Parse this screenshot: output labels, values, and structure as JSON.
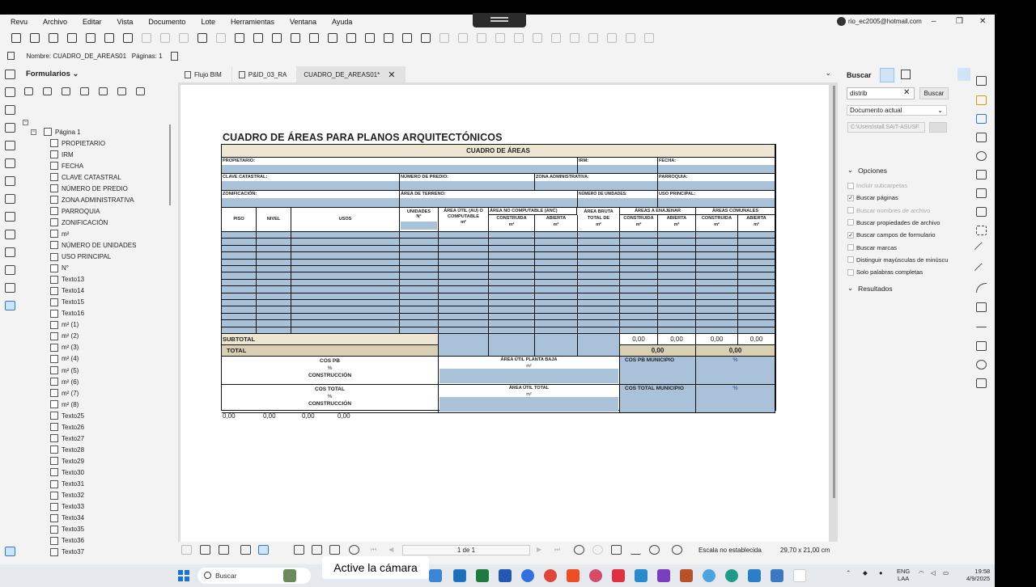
{
  "menu": [
    "Revu",
    "Archivo",
    "Editar",
    "Vista",
    "Documento",
    "Lote",
    "Herramientas",
    "Ventana",
    "Ayuda"
  ],
  "account": "rio_ec2005@hotmail.com",
  "window_controls": [
    "–",
    "❐",
    "✕"
  ],
  "namebar": {
    "name_label": "Nombre:",
    "name_value": "CUADRO_DE_AREAS01",
    "pages_label": "Páginas:",
    "pages_value": "1"
  },
  "panel": {
    "title": "Formularios ⌄",
    "root": "Página 1"
  },
  "tree_items": [
    "PROPIETARIO",
    "IRM",
    "FECHA",
    "CLAVE CATASTRAL",
    "NÚMERO DE PREDIO",
    "ZONA ADMINISTRATIVA",
    "PARROQUIA",
    "ZONIFICACIÓN",
    "m²",
    "NÚMERO DE UNIDADES",
    "USO PRINCIPAL",
    "N°",
    "Texto13",
    "Texto14",
    "Texto15",
    "Texto16",
    "m² (1)",
    "m² (2)",
    "m² (3)",
    "m² (4)",
    "m² (5)",
    "m² (6)",
    "m² (7)",
    "m² (8)",
    "Texto25",
    "Texto26",
    "Texto27",
    "Texto28",
    "Texto29",
    "Texto30",
    "Texto31",
    "Texto32",
    "Texto33",
    "Texto34",
    "Texto35",
    "Texto36",
    "Texto37"
  ],
  "tabs": [
    {
      "label": "Flujo BIM"
    },
    {
      "label": "P&ID_03_RA"
    },
    {
      "label": "CUADRO_DE_AREAS01*"
    }
  ],
  "doc": {
    "title": "CUADRO DE ÁREAS PARA PLANOS ARQUITECTÓNICOS",
    "header": "CUADRO DE ÁREAS",
    "propietario": "PROPIETARIO:",
    "irm": "IRM:",
    "fecha": "FECHA:",
    "clave": "CLAVE CATASTRAL:",
    "predio": "NÚMERO DE PREDIO:",
    "zona": "ZONA ADMINISTRATIVA:",
    "parroquia": "PARROQUIA:",
    "zonif": "ZONIFICACIÓN:",
    "area_terreno": "ÁREA DE TERRENO:",
    "num_unidades": "NÚMERO DE UNIDADES:",
    "uso_principal": "USO PRINCIPAL:",
    "col_piso": "PISO",
    "col_nivel": "NIVEL",
    "col_usos": "USOS",
    "col_unidades": "UNIDADES",
    "col_unidades_n": "N°",
    "col_util": "ÁREA ÚTIL (AU) O COMPUTABLE",
    "col_m2": "m²",
    "col_anc": "ÁREA NO COMPUTABLE (ANC)",
    "col_construida": "CONSTRUIDA",
    "col_abierta": "ABIERTA",
    "col_bruta": "ÁREA BRUTA TOTAL DE",
    "col_enajenar": "ÁREAS A ENAJENAR",
    "col_comunales": "ÁREAS COMUNALES",
    "subtotal": "SUBTOTAL",
    "total": "TOTAL",
    "subtotal_values": [
      "0,00",
      "0,00",
      "0,00",
      "0,00"
    ],
    "total_values": [
      "0,00",
      "0,00"
    ],
    "cos_pb": "COS PB",
    "pct": "%",
    "construccion": "CONSTRUCCIÓN",
    "area_util_pb": "ÁREA ÚTIL PLANTA BAJA",
    "cos_pb_mun": "COS PB MUNICIPIO",
    "cos_total": "COS TOTAL",
    "area_util_total": "ÁREA ÚTIL TOTAL",
    "cos_total_mun": "COS TOTAL MUNICIPIO",
    "below_values": [
      "0,00",
      "0,00",
      "0,00",
      "0,00"
    ]
  },
  "bottombar": {
    "page": "1 de 1",
    "scale": "Escala no establecida",
    "size": "29,70 x 21,00 cm"
  },
  "search": {
    "title": "Buscar",
    "query": "distrib",
    "button": "Buscar",
    "scope": "Documento actual",
    "path": "C:\\Users\\stall.SAIT-ASUSF",
    "options_title": "Opciones",
    "options": [
      {
        "label": "Incluir subcarpetas",
        "checked": false,
        "disabled": true
      },
      {
        "label": "Buscar páginas",
        "checked": true,
        "disabled": false
      },
      {
        "label": "Buscar nombres de archivo",
        "checked": false,
        "disabled": true
      },
      {
        "label": "Buscar propiedades de archivo",
        "checked": false,
        "disabled": false
      },
      {
        "label": "Buscar campos de formulario",
        "checked": true,
        "disabled": false
      },
      {
        "label": "Buscar marcas",
        "checked": false,
        "disabled": false
      },
      {
        "label": "Distinguir mayúsculas de minúscu",
        "checked": false,
        "disabled": false
      },
      {
        "label": "Solo palabras completas",
        "checked": false,
        "disabled": false
      }
    ],
    "results_title": "Resultados"
  },
  "taskbar": {
    "search": "Buscar",
    "lang1": "ENG",
    "lang2": "LAA",
    "time": "19:58",
    "date": "4/9/2025"
  },
  "camera_tip": "Active la cámara"
}
